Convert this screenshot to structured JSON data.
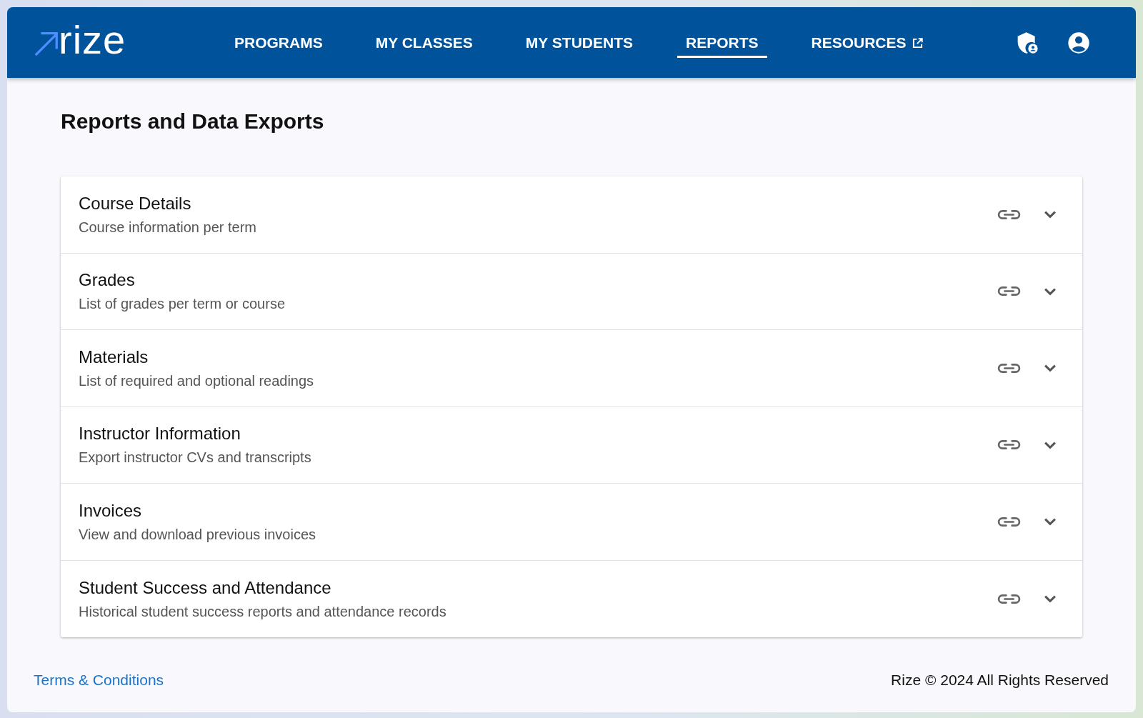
{
  "header": {
    "logo": "rize",
    "nav": [
      {
        "label": "PROGRAMS",
        "selected": false,
        "external": false
      },
      {
        "label": "MY CLASSES",
        "selected": false,
        "external": false
      },
      {
        "label": "MY STUDENTS",
        "selected": false,
        "external": false
      },
      {
        "label": "REPORTS",
        "selected": true,
        "external": false
      },
      {
        "label": "RESOURCES",
        "selected": false,
        "external": true
      }
    ]
  },
  "page_title": "Reports and Data Exports",
  "reports": [
    {
      "title": "Course Details",
      "subtitle": "Course information per term",
      "expanded": false
    },
    {
      "title": "Grades",
      "subtitle": "List of grades per term or course",
      "expanded": false
    },
    {
      "title": "Materials",
      "subtitle": "List of required and optional readings",
      "expanded": false
    },
    {
      "title": "Instructor Information",
      "subtitle": "Export instructor CVs and transcripts",
      "expanded": false
    },
    {
      "title": "Invoices",
      "subtitle": "View and download previous invoices",
      "expanded": false
    },
    {
      "title": "Student Success and Attendance",
      "subtitle": "Historical student success reports and attendance records",
      "expanded": false
    }
  ],
  "footer": {
    "link": "Terms & Conditions",
    "copyright": "Rize © 2024 All Rights Reserved"
  }
}
